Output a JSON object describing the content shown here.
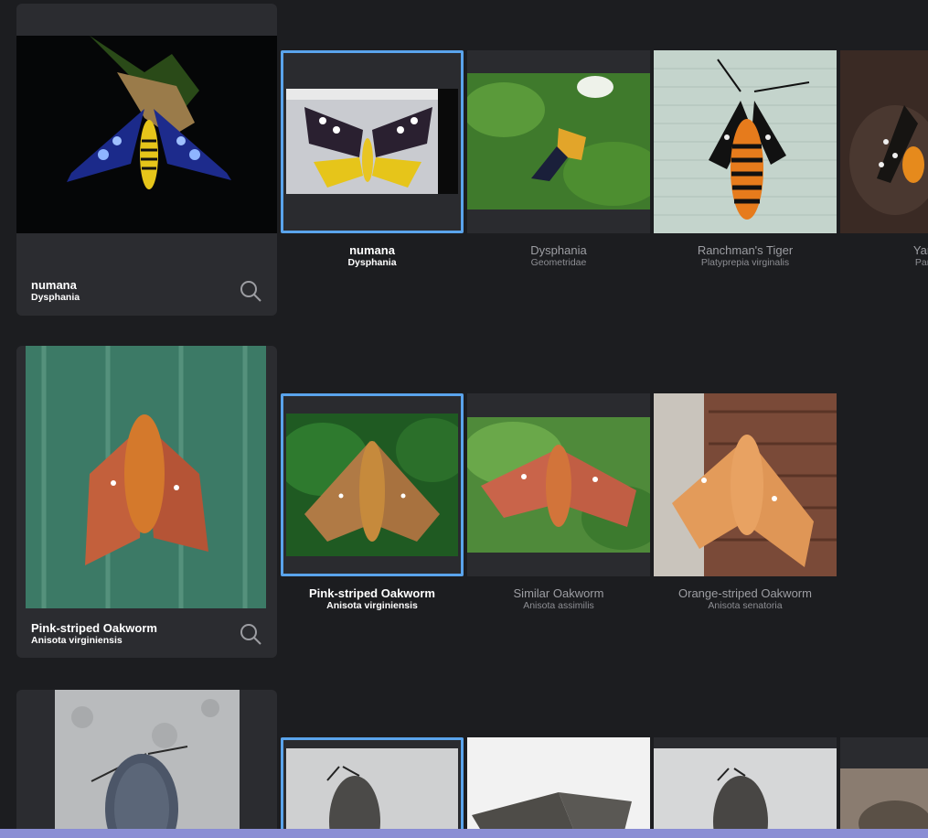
{
  "rows": [
    {
      "card": {
        "name": "numana",
        "scientific": "Dysphania",
        "icon": "search-icon"
      },
      "matches": [
        {
          "name": "numana",
          "scientific": "Dysphania",
          "selected": true
        },
        {
          "name": "Dysphania",
          "scientific": "Geometridae",
          "selected": false
        },
        {
          "name": "Ranchman's Tiger",
          "scientific": "Platyprepia virginalis",
          "selected": false
        },
        {
          "name": "Yarrow",
          "scientific": "Pararcti",
          "selected": false
        }
      ]
    },
    {
      "card": {
        "name": "Pink-striped Oakworm",
        "scientific": "Anisota virginiensis",
        "icon": "search-icon"
      },
      "matches": [
        {
          "name": "Pink-striped Oakworm",
          "scientific": "Anisota virginiensis",
          "selected": true
        },
        {
          "name": "Similar Oakworm",
          "scientific": "Anisota assimilis",
          "selected": false
        },
        {
          "name": "Orange-striped Oakworm",
          "scientific": "Anisota senatoria",
          "selected": false
        }
      ]
    }
  ],
  "colors": {
    "background": "#1c1d20",
    "card": "#2b2c30",
    "selection": "#5aa4ec",
    "bottom_bar": "#8a8ed4"
  }
}
